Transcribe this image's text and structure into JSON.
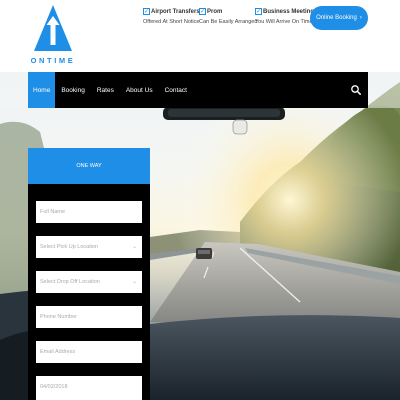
{
  "brand": {
    "logo_text": "ONTIME",
    "color": "#1f8ee6"
  },
  "features": [
    {
      "title": "Airport Transfers",
      "subtitle": "Offered At Short Notice"
    },
    {
      "title": "Prom",
      "subtitle": "Can Be Easily Arranged"
    },
    {
      "title": "Business Meetings",
      "subtitle": "You Will Arrive On Time"
    }
  ],
  "header": {
    "cta_label": "Online Booking",
    "cta_chevron": "›"
  },
  "nav": {
    "items": [
      "Home",
      "Booking",
      "Rates",
      "About Us",
      "Contact"
    ],
    "active": "Home",
    "search_icon": "search-icon"
  },
  "form": {
    "title": "ONE WAY",
    "full_name_placeholder": "Full Name",
    "pickup_placeholder": "Select Pick Up Location",
    "dropoff_placeholder": "Select Drop Off Location",
    "phone_placeholder": "Phone Number",
    "email_placeholder": "Email Address",
    "date_value": "04/02/2018",
    "dropdown_caret": "⌄"
  },
  "colors": {
    "accent": "#1f8ee6",
    "nav_bg": "#000000",
    "form_bg": "#000000"
  }
}
